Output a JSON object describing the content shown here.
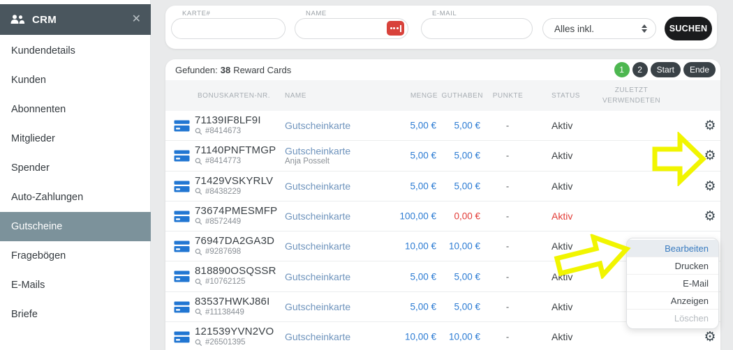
{
  "colors": {
    "sidebar_header_bg": "#4a565e",
    "sidebar_active_bg": "#7c929b",
    "page_bg": "#e9eaeb",
    "pager_green": "#4db750",
    "pager_dark": "#3a4247",
    "link_blue": "#6f94bd",
    "amount_blue": "#2b7bd3",
    "alert_red": "#e23b36",
    "annotation_yellow": "#f1f500",
    "suchen_black": "#1a1b1d",
    "card_icon_blue": "#2176d2",
    "password_icon_red": "#d8423b"
  },
  "sidebar": {
    "title": "CRM",
    "close_icon": "✕",
    "items": [
      {
        "label": "Kundendetails",
        "active": false
      },
      {
        "label": "Kunden",
        "active": false
      },
      {
        "label": "Abonnenten",
        "active": false
      },
      {
        "label": "Mitglieder",
        "active": false
      },
      {
        "label": "Spender",
        "active": false
      },
      {
        "label": "Auto-Zahlungen",
        "active": false
      },
      {
        "label": "Gutscheine",
        "active": true
      },
      {
        "label": "Fragebögen",
        "active": false
      },
      {
        "label": "E-Mails",
        "active": false
      },
      {
        "label": "Briefe",
        "active": false
      }
    ]
  },
  "search": {
    "fields": [
      {
        "label": "KARTE#",
        "value": "",
        "placeholder": ""
      },
      {
        "label": "NAME",
        "value": "",
        "placeholder": "",
        "has_password_manager_icon": true
      },
      {
        "label": "E-MAIL",
        "value": "",
        "placeholder": ""
      }
    ],
    "filter_selected": "Alles inkl.",
    "submit_label": "SUCHEN"
  },
  "results": {
    "found_prefix": "Gefunden:",
    "found_count": "38",
    "found_suffix": "Reward Cards",
    "pagination": [
      {
        "label": "1",
        "type": "page",
        "active": true
      },
      {
        "label": "2",
        "type": "page",
        "active": false
      },
      {
        "label": "Start",
        "type": "nav",
        "active": false
      },
      {
        "label": "Ende",
        "type": "nav",
        "active": false
      }
    ]
  },
  "table": {
    "columns": [
      "BONUSKARTEN-NR.",
      "NAME",
      "MENGE",
      "GUTHABEN",
      "PUNKTE",
      "STATUS",
      "ZULETZT VERWENDETEN"
    ],
    "rows": [
      {
        "card_no": "71139IF8LF9I",
        "ref": "#8414673",
        "name": "Gutscheinkarte",
        "holder": "",
        "menge": "5,00 €",
        "guthaben": "5,00 €",
        "guthaben_red": false,
        "punkte": "-",
        "status": "Aktiv",
        "status_red": false
      },
      {
        "card_no": "71140PNFTMGP",
        "ref": "#8414773",
        "name": "Gutscheinkarte",
        "holder": "Anja Posselt",
        "menge": "5,00 €",
        "guthaben": "5,00 €",
        "guthaben_red": false,
        "punkte": "-",
        "status": "Aktiv",
        "status_red": false
      },
      {
        "card_no": "71429VSKYRLV",
        "ref": "#8438229",
        "name": "Gutscheinkarte",
        "holder": "",
        "menge": "5,00 €",
        "guthaben": "5,00 €",
        "guthaben_red": false,
        "punkte": "-",
        "status": "Aktiv",
        "status_red": false
      },
      {
        "card_no": "73674PMESMFP",
        "ref": "#8572449",
        "name": "Gutscheinkarte",
        "holder": "",
        "menge": "100,00 €",
        "guthaben": "0,00 €",
        "guthaben_red": true,
        "punkte": "-",
        "status": "Aktiv",
        "status_red": true
      },
      {
        "card_no": "76947DA2GA3D",
        "ref": "#9287698",
        "name": "Gutscheinkarte",
        "holder": "",
        "menge": "10,00 €",
        "guthaben": "10,00 €",
        "guthaben_red": false,
        "punkte": "-",
        "status": "Aktiv",
        "status_red": false
      },
      {
        "card_no": "818890OSQSSR",
        "ref": "#10762125",
        "name": "Gutscheinkarte",
        "holder": "",
        "menge": "5,00 €",
        "guthaben": "5,00 €",
        "guthaben_red": false,
        "punkte": "-",
        "status": "Aktiv",
        "status_red": false
      },
      {
        "card_no": "83537HWKJ86I",
        "ref": "#11138449",
        "name": "Gutscheinkarte",
        "holder": "",
        "menge": "5,00 €",
        "guthaben": "5,00 €",
        "guthaben_red": false,
        "punkte": "-",
        "status": "Aktiv",
        "status_red": false
      },
      {
        "card_no": "121539YVN2VO",
        "ref": "#26501395",
        "name": "Gutscheinkarte",
        "holder": "",
        "menge": "10,00 €",
        "guthaben": "10,00 €",
        "guthaben_red": false,
        "punkte": "-",
        "status": "Aktiv",
        "status_red": false
      }
    ],
    "gear_icon": "⚙"
  },
  "context_menu": {
    "items": [
      {
        "label": "Bearbeiten",
        "state": "highlighted"
      },
      {
        "label": "Drucken",
        "state": "normal"
      },
      {
        "label": "E-Mail",
        "state": "normal"
      },
      {
        "label": "Anzeigen",
        "state": "normal"
      },
      {
        "label": "Löschen",
        "state": "disabled"
      }
    ]
  }
}
